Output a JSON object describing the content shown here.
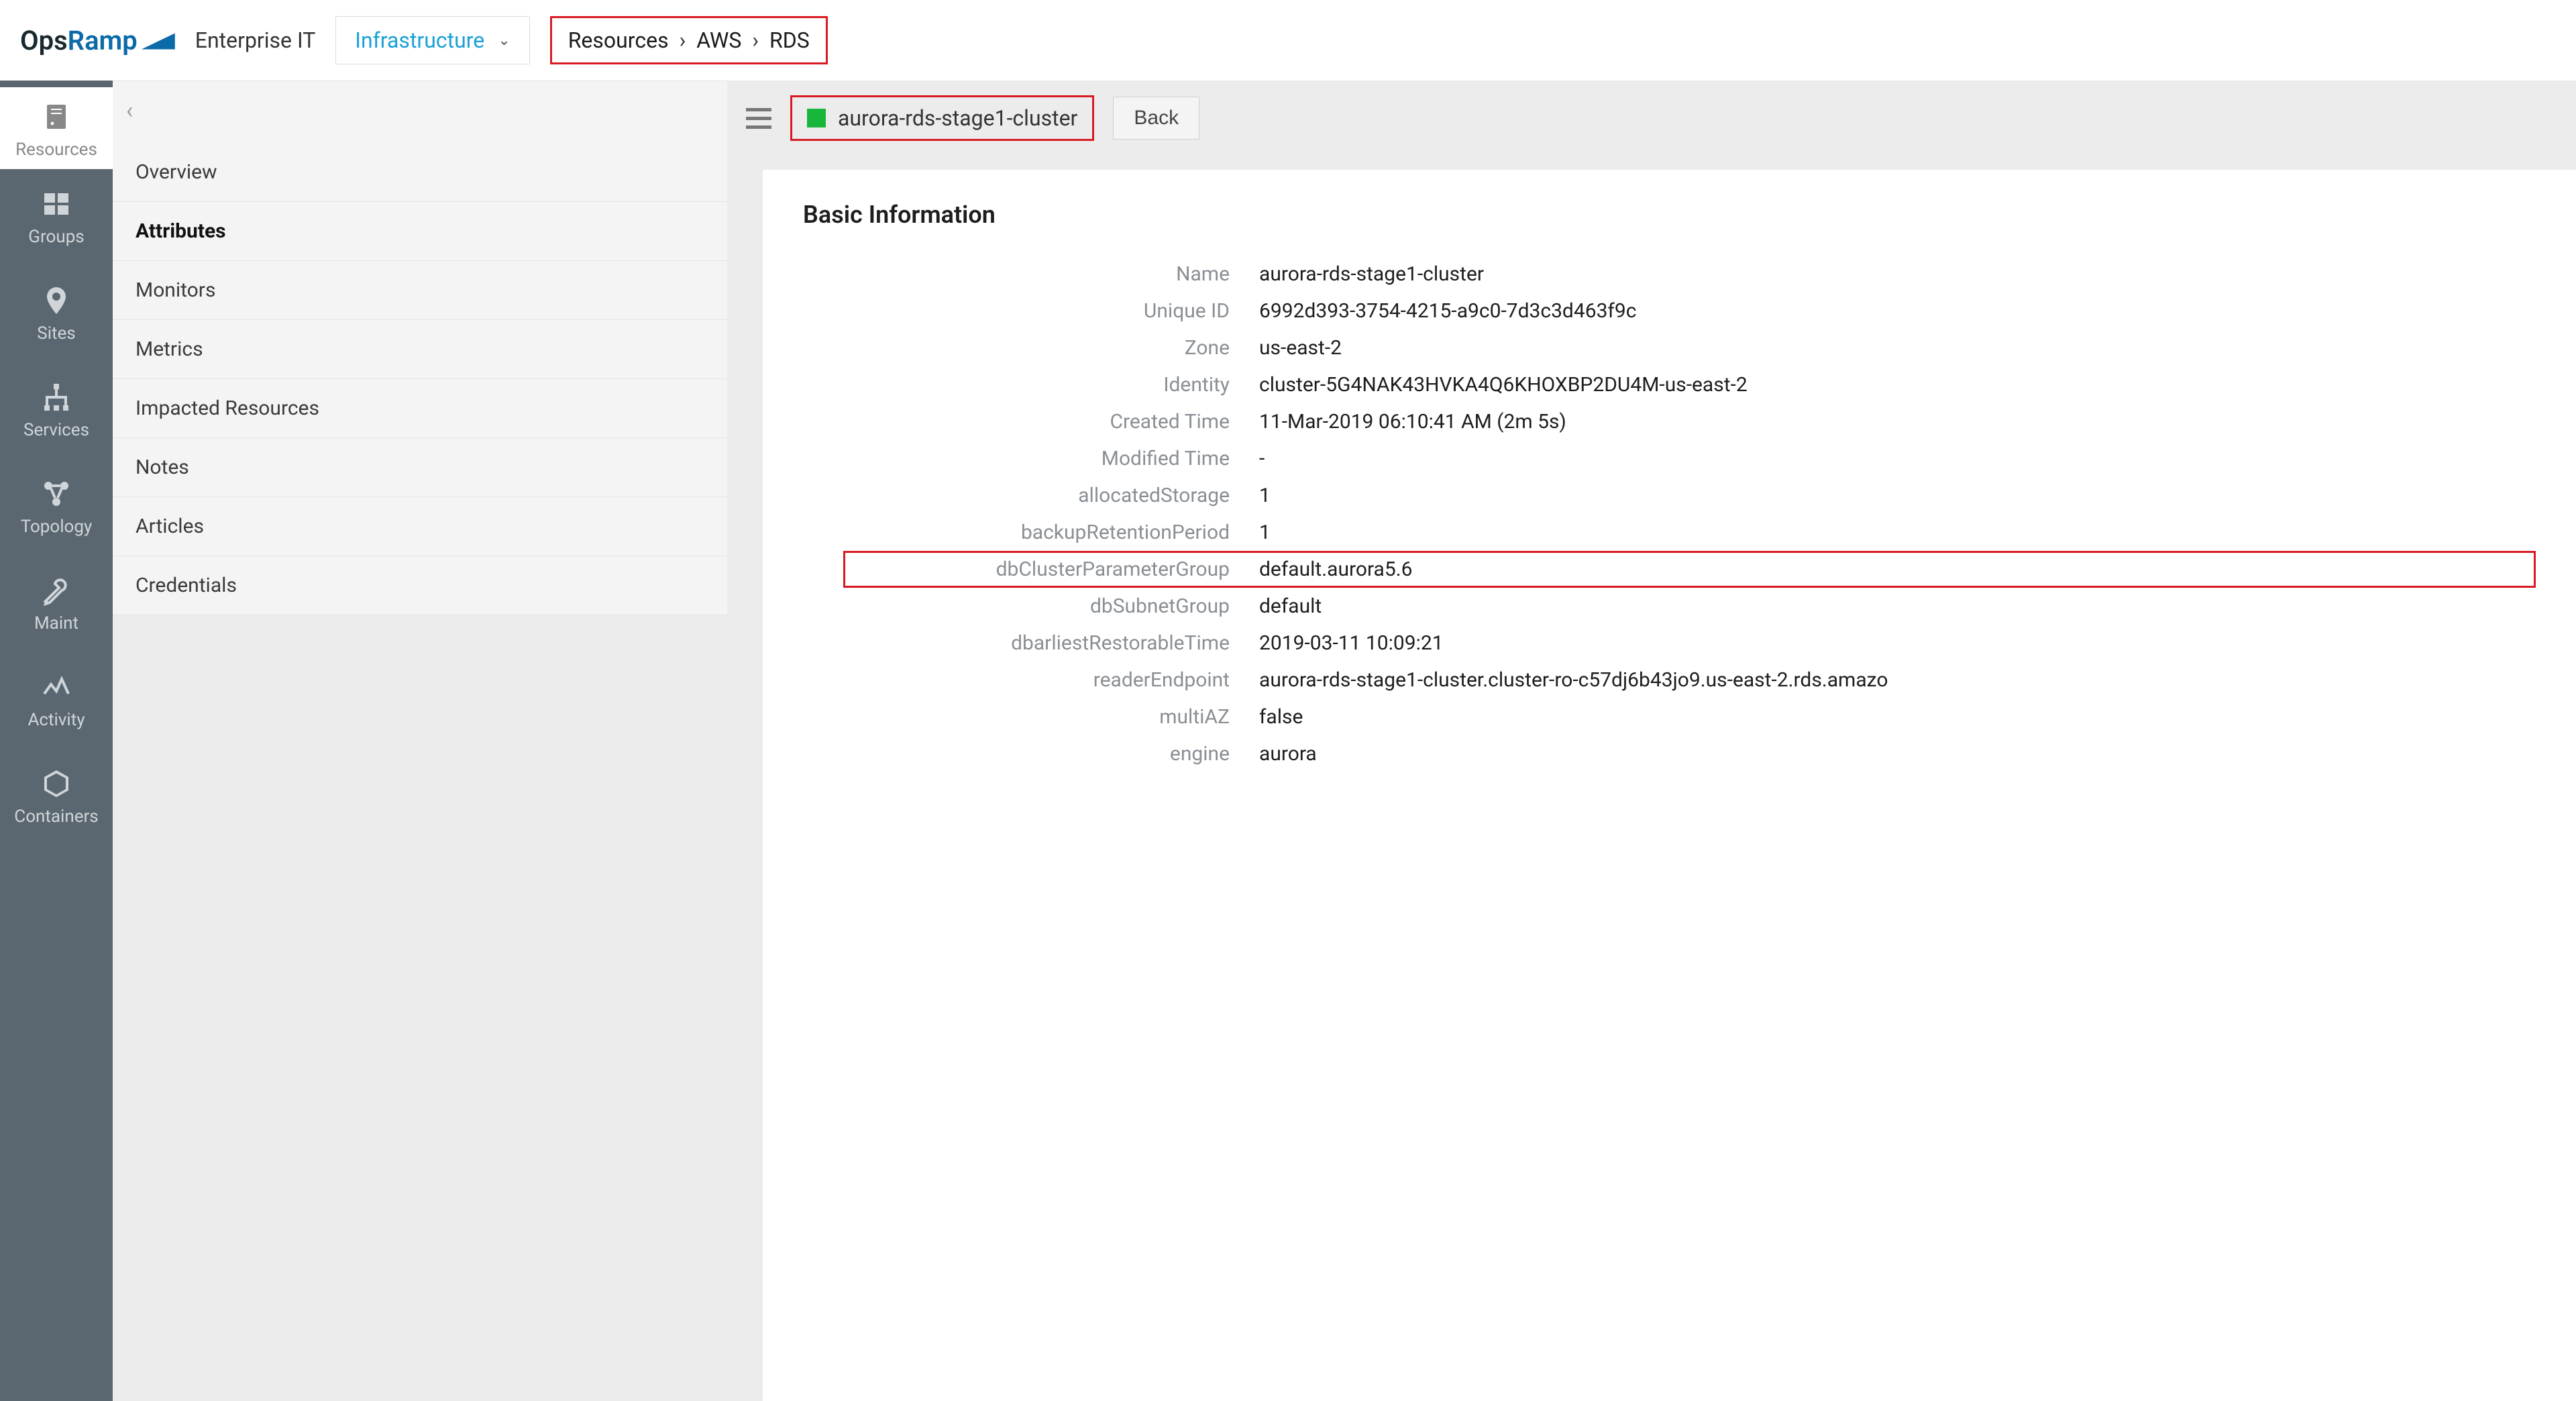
{
  "brand": {
    "part1": "Ops",
    "part2": "Ramp"
  },
  "tenant": "Enterprise IT",
  "nav": {
    "label": "Infrastructure"
  },
  "breadcrumb": [
    "Resources",
    "AWS",
    "RDS"
  ],
  "rail": [
    {
      "id": "resources",
      "label": "Resources"
    },
    {
      "id": "groups",
      "label": "Groups"
    },
    {
      "id": "sites",
      "label": "Sites"
    },
    {
      "id": "services",
      "label": "Services"
    },
    {
      "id": "topology",
      "label": "Topology"
    },
    {
      "id": "maint",
      "label": "Maint"
    },
    {
      "id": "activity",
      "label": "Activity"
    },
    {
      "id": "containers",
      "label": "Containers"
    }
  ],
  "panel": {
    "items": [
      "Overview",
      "Attributes",
      "Monitors",
      "Metrics",
      "Impacted Resources",
      "Notes",
      "Articles",
      "Credentials"
    ],
    "active": 1
  },
  "header": {
    "title": "aurora-rds-stage1-cluster",
    "status_color": "#18b63b",
    "back": "Back"
  },
  "section_title": "Basic Information",
  "attrs": [
    {
      "k": "Name",
      "v": "aurora-rds-stage1-cluster"
    },
    {
      "k": "Unique ID",
      "v": "6992d393-3754-4215-a9c0-7d3c3d463f9c"
    },
    {
      "k": "Zone",
      "v": "us-east-2"
    },
    {
      "k": "Identity",
      "v": "cluster-5G4NAK43HVKA4Q6KHOXBP2DU4M-us-east-2"
    },
    {
      "k": "Created Time",
      "v": "11-Mar-2019 06:10:41 AM (2m 5s)"
    },
    {
      "k": "Modified Time",
      "v": "-"
    },
    {
      "k": "allocatedStorage",
      "v": "1"
    },
    {
      "k": "backupRetentionPeriod",
      "v": "1"
    },
    {
      "k": "dbClusterParameterGroup",
      "v": "default.aurora5.6",
      "highlight": true
    },
    {
      "k": "dbSubnetGroup",
      "v": "default"
    },
    {
      "k": "dbarliestRestorableTime",
      "v": "2019-03-11 10:09:21"
    },
    {
      "k": "readerEndpoint",
      "v": "aurora-rds-stage1-cluster.cluster-ro-c57dj6b43jo9.us-east-2.rds.amazo"
    },
    {
      "k": "multiAZ",
      "v": "false"
    },
    {
      "k": "engine",
      "v": "aurora"
    }
  ]
}
